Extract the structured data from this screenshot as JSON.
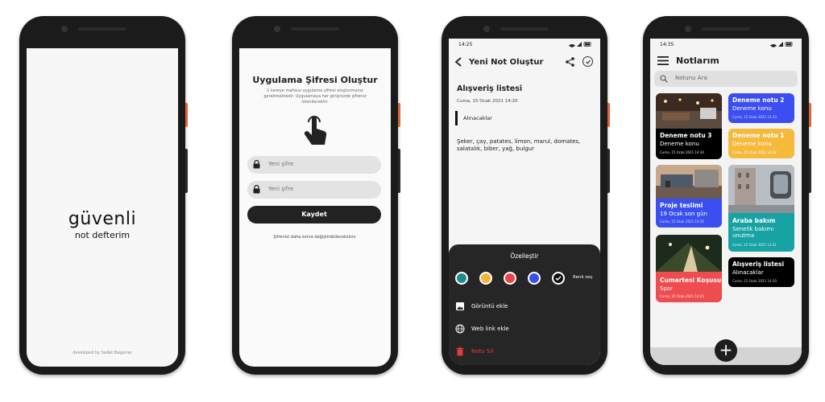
{
  "splash": {
    "logo_line1": "güvenli",
    "logo_line2": "not defterim",
    "developer": "developed by Sedat Başpınar"
  },
  "password_screen": {
    "title": "Uygulama Şifresi Oluştur",
    "description": "1 kereye mahsus uygulama şifresi oluşturmanız gerekmektedir. Uygulamaya her girişinizde şifreniz istenilecektir.",
    "new_password_placeholder_1": "Yeni şifre",
    "new_password_placeholder_2": "Yeni şifre",
    "save_label": "Kaydet",
    "footer": "Şifrenizi daha sonra değiştirebileceksiniz."
  },
  "new_note": {
    "status_time": "14:25",
    "header_title": "Yeni Not Oluştur",
    "note_title": "Alışveriş listesi",
    "date": "Cuma, 15 Ocak 2021 14:20",
    "subtitle": "Alınacaklar",
    "body": "Şeker, çay, patates, limon, marul, domates, salatalık, biber, yağ, bulgur",
    "sheet": {
      "title": "Özelleştir",
      "color_label": "Renk seç",
      "colors": [
        "#1e8c8c",
        "#f2b53a",
        "#e9464c",
        "#3b4ee8",
        "#111111"
      ],
      "add_image": "Görüntü ekle",
      "add_link": "Web link ekle",
      "delete": "Notu Sil"
    }
  },
  "notes_list": {
    "status_time": "14:35",
    "header_title": "Notlarım",
    "search_placeholder": "Notunu Ara",
    "notes": [
      {
        "title": "Deneme notu 3",
        "subtitle": "Deneme konu",
        "date": "Cuma, 15 Ocak 2021 14:34",
        "color": "#000000",
        "has_image": true
      },
      {
        "title": "Deneme notu 2",
        "subtitle": "Deneme konu",
        "date": "Cuma, 15 Ocak 2021 14:33",
        "color": "#3b4ef0",
        "has_image": false
      },
      {
        "title": "Deneme notu 1",
        "subtitle": "Deneme konu",
        "date": "Cuma, 15 Ocak 2021 14:32",
        "color": "#f5b93c",
        "has_image": false
      },
      {
        "title": "Proje teslimi",
        "subtitle": "19 Ocak son gün",
        "date": "Cuma, 15 Ocak 2021 14:35",
        "color": "#3b4ef0",
        "has_image": true
      },
      {
        "title": "Araba bakım",
        "subtitle": "Senelik bakımı unutma",
        "date": "Cuma, 15 Ocak 2021 14:31",
        "color": "#17a2a4",
        "has_image": true
      },
      {
        "title": "Cumartesi Koşusu",
        "subtitle": "Spor",
        "date": "Cuma, 15 Ocak 2021 14:23",
        "color": "#ef4c50",
        "has_image": true
      },
      {
        "title": "Alışveriş listesi",
        "subtitle": "Alınacaklar",
        "date": "Cuma, 15 Ocak 2021 14:20",
        "color": "#000000",
        "has_image": false
      }
    ],
    "add_label": "+"
  }
}
